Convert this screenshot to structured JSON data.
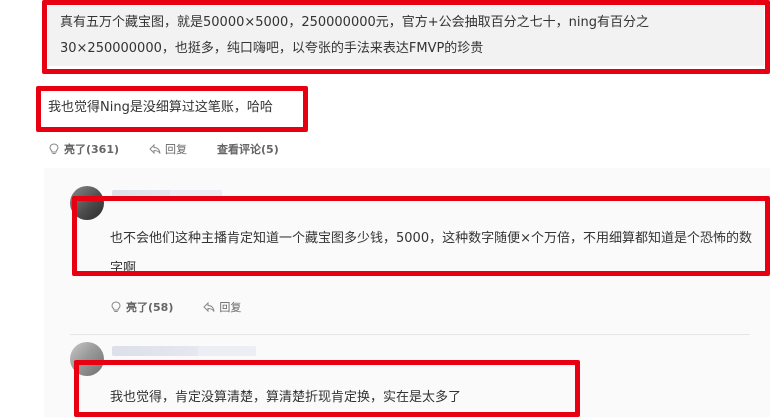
{
  "quote": {
    "text": "真有五万个藏宝图，就是50000×5000，250000000元，官方+公会抽取百分之七十，ning有百分之30×250000000，也挺多，纯口嗨吧，以夸张的手法来表达FMVP的珍贵"
  },
  "reply": {
    "text": "我也觉得Ning是没细算过这笔账，哈哈",
    "actions": {
      "like_label": "亮了(361)",
      "reply_label": "回复",
      "view_comments_label": "查看评论(5)"
    }
  },
  "sub_comments": [
    {
      "text": "也不会他们这种主播肯定知道一个藏宝图多少钱，5000，这种数字随便×个万倍，不用细算都知道是个恐怖的数字啊",
      "like_label": "亮了(58)",
      "reply_label": "回复"
    },
    {
      "text": "我也觉得，肯定没算清楚，算清楚折现肯定换，实在是太多了"
    }
  ],
  "colors": {
    "annotation_red": "#e60012",
    "quote_bg": "#f2f2f2",
    "subpanel_bg": "#fafafa"
  },
  "icons": {
    "like": "lightbulb-icon",
    "reply": "reply-arrow-icon"
  }
}
